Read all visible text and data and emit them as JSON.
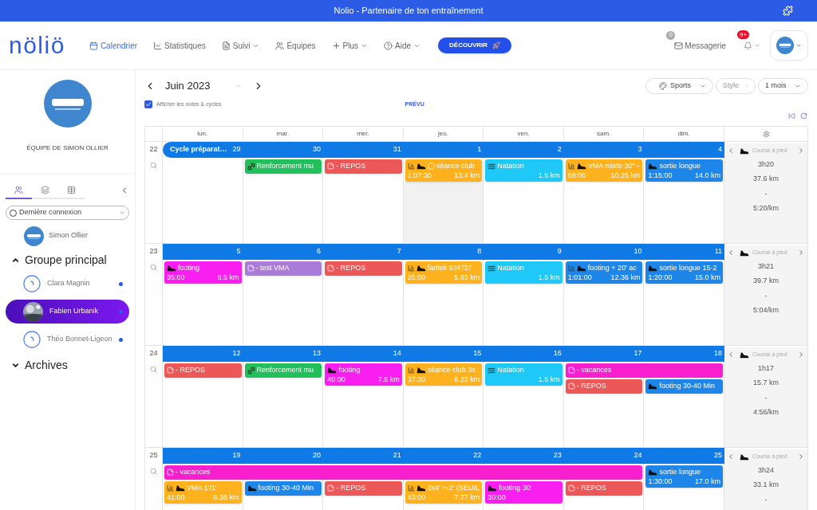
{
  "titlebar": {
    "title": "Nolio - Partenaire de ton entraînement"
  },
  "nav": {
    "logo": "nöliö",
    "items": [
      {
        "label": "Calendrier",
        "selected": true,
        "caret": false
      },
      {
        "label": "Statistiques",
        "selected": false,
        "caret": false
      },
      {
        "label": "Suivi",
        "selected": false,
        "caret": true
      },
      {
        "label": "Équipes",
        "selected": false,
        "caret": false
      },
      {
        "label": "Plus",
        "selected": false,
        "caret": true
      },
      {
        "label": "Aide",
        "selected": false,
        "caret": true
      }
    ],
    "discover_button": "DÉCOUVRIR",
    "messages": {
      "label": "Messagerie",
      "badge": "0"
    },
    "notifications": {
      "badge": "9+"
    }
  },
  "sidebar": {
    "team_name": "ÉQUIPE DE SIMON OLLIER",
    "tabs": [
      {
        "selected": true
      },
      {
        "selected": false
      },
      {
        "selected": false
      }
    ],
    "filter": {
      "value": "Dernière connexion"
    },
    "coach": {
      "name": "Simon Ollier"
    },
    "groups": [
      {
        "name": "Groupe principal",
        "expanded": true,
        "children": [
          {
            "name": "Clara Magnin",
            "selected": false,
            "online": true,
            "photo": false
          },
          {
            "name": "Fabien Urbanik",
            "selected": true,
            "online": true,
            "photo": true
          },
          {
            "name": "Théo Bonnet-Ligeon",
            "selected": false,
            "online": true,
            "photo": false
          }
        ]
      },
      {
        "name": "Archives",
        "expanded": false
      }
    ]
  },
  "calendar": {
    "month": "Juin 2023",
    "filters": [
      "Sports",
      "Style",
      "1 mois"
    ],
    "show_notes": {
      "label": "Afficher les notes & cycles",
      "checked": true
    },
    "mode": "PRÉVU",
    "weekdays": [
      "lun.",
      "mar.",
      "mer.",
      "jeu.",
      "ven.",
      "sam.",
      "dim."
    ],
    "weeks": [
      {
        "number": "22",
        "cycle": {
          "label": "Cycle préparat…"
        },
        "days": [
          {
            "date": "29",
            "shaded": false
          },
          {
            "date": "30",
            "shaded": false,
            "events": [
              {
                "kind": "strength",
                "structured": false,
                "comment": false,
                "title": "Renforcement mu",
                "color": "#22c05c"
              }
            ]
          },
          {
            "date": "31",
            "shaded": false,
            "events": [
              {
                "kind": "note",
                "structured": false,
                "comment": false,
                "title": "- REPOS",
                "color": "#ec5757"
              }
            ]
          },
          {
            "date": "1",
            "shaded": true,
            "events": [
              {
                "kind": "running",
                "structured": true,
                "comment": true,
                "title": "séance club",
                "duration": "1:07:30",
                "distance": "13.4 km",
                "color": "#ffb21e"
              }
            ]
          },
          {
            "date": "2",
            "shaded": false,
            "events": [
              {
                "kind": "swimming",
                "structured": false,
                "comment": false,
                "title": "Natation",
                "distance": "1.5 km",
                "color": "#1ec8f7"
              }
            ]
          },
          {
            "date": "3",
            "shaded": false,
            "events": [
              {
                "kind": "running",
                "structured": true,
                "comment": false,
                "title": "VMA mixte 30'' -",
                "duration": "58:00",
                "distance": "10.25 km",
                "color": "#ffb21e"
              }
            ]
          },
          {
            "date": "4",
            "shaded": false,
            "events": [
              {
                "kind": "running",
                "structured": false,
                "comment": false,
                "title": "sortie longue",
                "duration": "1:15:00",
                "distance": "14.0 km",
                "color": "#1e86e8"
              }
            ]
          }
        ],
        "summary": {
          "sport": "Course à pied",
          "lines": [
            "3h20",
            "37.6 km",
            "-",
            "5:20/km"
          ]
        }
      },
      {
        "number": "23",
        "days": [
          {
            "date": "5",
            "shaded": false,
            "events": [
              {
                "kind": "running",
                "structured": false,
                "comment": false,
                "title": "footing",
                "duration": "35:00",
                "distance": "6.5 km",
                "color": "#f81ff0"
              }
            ]
          },
          {
            "date": "6",
            "shaded": false,
            "events": [
              {
                "kind": "note",
                "structured": false,
                "comment": false,
                "title": "- test VMA",
                "color": "#ab7bd8"
              }
            ]
          },
          {
            "date": "7",
            "shaded": false,
            "events": [
              {
                "kind": "note",
                "structured": false,
                "comment": false,
                "title": "- REPOS",
                "color": "#ec5757"
              }
            ]
          },
          {
            "date": "8",
            "shaded": false,
            "events": [
              {
                "kind": "running",
                "structured": true,
                "comment": false,
                "title": "fartlek 5'/4'/3'/",
                "duration": "25:00",
                "distance": "5.83 km",
                "color": "#ffb21e"
              }
            ]
          },
          {
            "date": "9",
            "shaded": false,
            "events": [
              {
                "kind": "swimming",
                "structured": false,
                "comment": false,
                "title": "Natation",
                "distance": "1.5 km",
                "color": "#1ec8f7"
              }
            ]
          },
          {
            "date": "10",
            "shaded": false,
            "events": [
              {
                "kind": "running",
                "structured": true,
                "comment": false,
                "title": "footing + 20' ac",
                "duration": "1:01:00",
                "distance": "12.36 km",
                "color": "#1e86e8"
              }
            ]
          },
          {
            "date": "11",
            "shaded": false,
            "events": [
              {
                "kind": "running",
                "structured": false,
                "comment": false,
                "title": "sortie longue 15-2",
                "duration": "1:20:00",
                "distance": "15.0 km",
                "color": "#1e86e8"
              }
            ]
          }
        ],
        "summary": {
          "sport": "Course à pied",
          "lines": [
            "3h21",
            "39.7 km",
            "-",
            "5:04/km"
          ]
        }
      },
      {
        "number": "24",
        "days": [
          {
            "date": "12",
            "shaded": false,
            "events": [
              {
                "kind": "note",
                "structured": false,
                "comment": false,
                "title": "- REPOS",
                "color": "#ec5757"
              }
            ]
          },
          {
            "date": "13",
            "shaded": false,
            "events": [
              {
                "kind": "strength",
                "structured": false,
                "comment": false,
                "title": "Renforcement mu",
                "color": "#22c05c"
              }
            ]
          },
          {
            "date": "14",
            "shaded": false,
            "events": [
              {
                "kind": "running",
                "structured": false,
                "comment": false,
                "title": "footing",
                "duration": "40:00",
                "distance": "7.5 km",
                "color": "#f81ff0"
              }
            ]
          },
          {
            "date": "15",
            "shaded": false,
            "events": [
              {
                "kind": "running",
                "structured": true,
                "comment": false,
                "title": "séance club 3x",
                "duration": "37:30",
                "distance": "8.23 km",
                "color": "#ffb21e"
              }
            ]
          },
          {
            "date": "16",
            "shaded": false,
            "events": [
              {
                "kind": "swimming",
                "structured": false,
                "comment": false,
                "title": "Natation",
                "distance": "1.5 km",
                "color": "#1ec8f7"
              }
            ]
          },
          {
            "date": "17",
            "shaded": false,
            "events": [
              {
                "kind": "note",
                "structured": false,
                "comment": false,
                "title": "- vacances",
                "color": "#f81fcf"
              },
              {
                "kind": "note",
                "structured": false,
                "comment": false,
                "title": "- REPOS",
                "color": "#ec5757"
              }
            ]
          },
          {
            "date": "18",
            "shaded": false,
            "continues_note": true,
            "events": [
              {
                "kind": "running",
                "structured": false,
                "comment": false,
                "title": "footing 30-40 Min",
                "color": "#1e86e8"
              }
            ]
          }
        ],
        "summary": {
          "sport": "Course à pied",
          "lines": [
            "1h17",
            "15.7 km",
            "-",
            "4:56/km"
          ]
        }
      },
      {
        "number": "25",
        "days": [
          {
            "date": "19",
            "shaded": false,
            "events": [
              {
                "kind": "note",
                "structured": false,
                "comment": false,
                "title": "- vacances",
                "color": "#f81fcf"
              },
              {
                "kind": "running",
                "structured": true,
                "comment": false,
                "title": "VMA 1'/1'",
                "duration": "41:00",
                "distance": "8.38 km",
                "color": "#ffb21e"
              }
            ]
          },
          {
            "date": "20",
            "shaded": false,
            "continues_note": true,
            "events": [
              {
                "kind": "running",
                "structured": false,
                "comment": false,
                "title": "footing 30-40 Min",
                "color": "#1e86e8"
              }
            ]
          },
          {
            "date": "21",
            "shaded": false,
            "continues_note": true,
            "events": [
              {
                "kind": "note",
                "structured": false,
                "comment": false,
                "title": "- REPOS",
                "color": "#ec5757"
              }
            ]
          },
          {
            "date": "22",
            "shaded": false,
            "continues_note": true,
            "events": [
              {
                "kind": "running",
                "structured": true,
                "comment": false,
                "title": "3x4' r=2' (SEUIL",
                "duration": "43:00",
                "distance": "7.77 km",
                "color": "#ffb21e"
              }
            ]
          },
          {
            "date": "23",
            "shaded": false,
            "continues_note": true,
            "events": [
              {
                "kind": "running",
                "structured": false,
                "comment": false,
                "title": "footing 30'",
                "duration": "30:00",
                "color": "#f81ff0"
              }
            ]
          },
          {
            "date": "24",
            "shaded": false,
            "continues_note": true,
            "events": [
              {
                "kind": "note",
                "structured": false,
                "comment": false,
                "title": "- REPOS",
                "color": "#ec5757"
              }
            ]
          },
          {
            "date": "25",
            "shaded": false,
            "events": [
              {
                "kind": "running",
                "structured": false,
                "comment": false,
                "title": "sortie longue",
                "duration": "1:30:00",
                "distance": "17.0 km",
                "color": "#1e86e8"
              }
            ]
          }
        ],
        "summary": {
          "sport": "Course à pied",
          "lines": [
            "3h24",
            "33.1 km",
            "-"
          ]
        }
      }
    ]
  }
}
